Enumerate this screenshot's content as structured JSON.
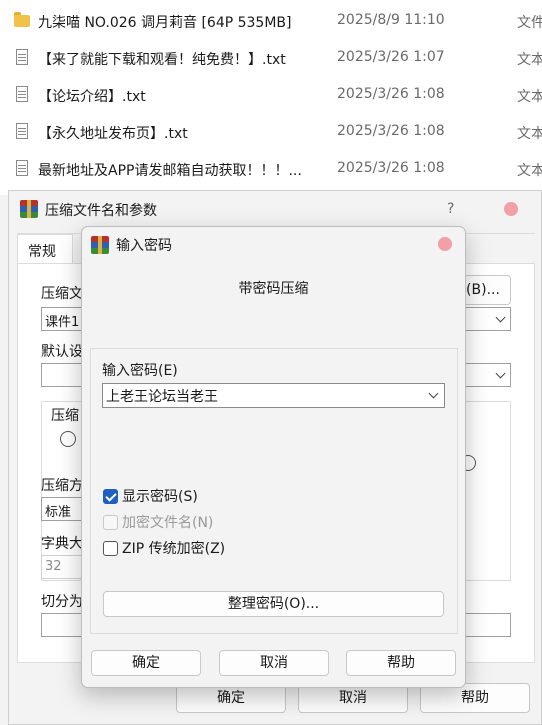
{
  "files": [
    {
      "icon": "folder-icon",
      "name": "九柒喵 NO.026 调月莉音 [64P 535MB]",
      "date": "2025/8/9 11:10",
      "type": "文件"
    },
    {
      "icon": "text-file-icon",
      "name": "【来了就能下载和观看！纯免费！】.txt",
      "date": "2025/3/26 1:07",
      "type": "文本"
    },
    {
      "icon": "text-file-icon",
      "name": "【论坛介绍】.txt",
      "date": "2025/3/26 1:08",
      "type": "文本"
    },
    {
      "icon": "text-file-icon",
      "name": "【永久地址发布页】.txt",
      "date": "2025/3/26 1:08",
      "type": "文本"
    },
    {
      "icon": "text-file-icon",
      "name": "最新地址及APP请发邮箱自动获取！！！...",
      "date": "2025/3/26 1:08",
      "type": "文本"
    }
  ],
  "archive_dialog": {
    "title": "压缩文件名和参数",
    "help": "?",
    "tab_general": "常规",
    "label_archive_name": "压缩文",
    "archive_name_value": "课件1",
    "browse_label": "(B)...",
    "label_default": "默认设",
    "label_format": "压缩",
    "label_method": "压缩方",
    "method_value": "标准",
    "label_dict": "字典大",
    "dict_value": "32",
    "label_split": "切分为",
    "ok": "确定",
    "cancel": "取消",
    "help_btn": "帮助"
  },
  "password_dialog": {
    "title": "输入密码",
    "heading": "带密码压缩",
    "password_label": "输入密码(E)",
    "password_value": "上老王论坛当老王",
    "show_password": "显示密码(S)",
    "show_password_checked": true,
    "encrypt_names": "加密文件名(N)",
    "encrypt_names_enabled": false,
    "zip_legacy": "ZIP 传统加密(Z)",
    "zip_legacy_checked": false,
    "organize_button": "整理密码(O)...",
    "ok": "确定",
    "cancel": "取消",
    "help": "帮助"
  },
  "colors": {
    "accent": "#1f5fbf",
    "close": "#f0a0a6",
    "folder": "#f0c24a"
  }
}
